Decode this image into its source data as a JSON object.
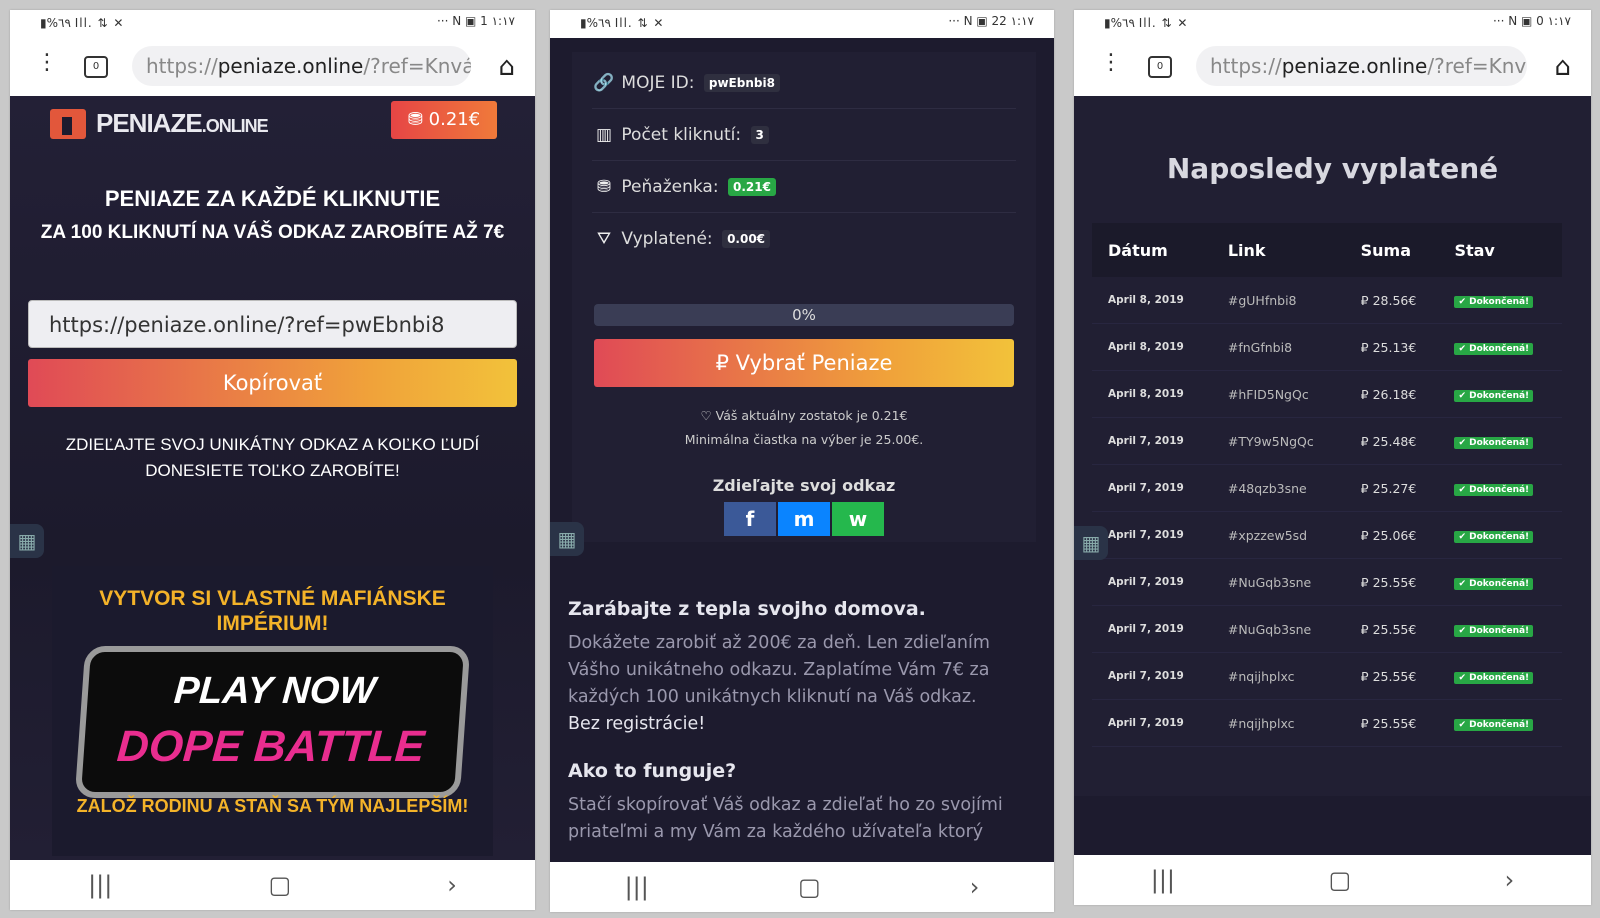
{
  "status_bar": {
    "left": "▮%٦٩ Ill. ⇅ ✕",
    "right": "··· N ▣ 1 ١:١٧",
    "right2": "··· N ▣ 22 ١:١٧",
    "right3": "··· N ▣ 0 ١:١٧"
  },
  "browser": {
    "url_prefix": "https://",
    "url_host": "peniaze.online",
    "url_rest": "/?ref=Knvá",
    "tab_count": "0"
  },
  "panel1": {
    "logo_main": "PENIAZE",
    "logo_sub": ".ONLINE",
    "balance": "0.21€",
    "headline": "PENIAZE ZA KAŽDÉ KLIKNUTIE",
    "subheadline": "ZA 100 KLIKNUTÍ NA VÁŠ ODKAZ ZAROBÍTE AŽ 7€",
    "ref_link": "https://peniaze.online/?ref=pwEbnbi8",
    "copy_button": "Kopírovať",
    "share_text": "ZDIEĽAJTE SVOJ UNIKÁTNY ODKAZ A KOĽKO ĽUDÍ DONESIETE TOĽKO ZAROBÍTE!",
    "banner": {
      "top": "VYTVOR SI VLASTNÉ MAFIÁNSKE IMPÉRIUM!",
      "play": "PLAY NOW",
      "game": "DOPE BATTLE",
      "bottom": "ZALOŽ RODINU A STAŇ SA TÝM NAJLEPŠÍM!"
    }
  },
  "panel2": {
    "my_id_label": "MOJE ID:",
    "my_id": "pwEbnbi8",
    "clicks_label": "Počet kliknutí:",
    "clicks": "3",
    "wallet_label": "Peňaženka:",
    "wallet": "0.21€",
    "paid_label": "Vyplatené:",
    "paid": "0.00€",
    "progress_text": "0%",
    "progress_fraction": 0,
    "withdraw_button": "Vybrať Peniaze",
    "balance_note": "Váš aktuálny zostatok je 0.21€",
    "min_note": "Minimálna čiastka na výber je 25.00€.",
    "share_heading": "Zdieľajte svoj odkaz",
    "share_buttons": [
      "f",
      "m",
      "w"
    ],
    "earn_heading": "Zarábajte z tepla svojho domova.",
    "earn_text": "Dokážete zarobiť až 200€ za deň. Len zdieľaním Vášho unikátneho odkazu. Zaplatíme Vám 7€ za každých 100 unikátnych kliknutí na Váš odkaz.",
    "earn_bold": "Bez registrácie!",
    "how_heading": "Ako to funguje?",
    "how_text": "Stačí skopírovať Váš odkaz a zdieľať ho zo svojími priateľmi a my Vám za každého užívateľa ktorý"
  },
  "panel3": {
    "title": "Naposledy vyplatené",
    "columns": [
      "Dátum",
      "Link",
      "Suma",
      "Stav"
    ],
    "rows": [
      {
        "date": "April 8, 2019",
        "link": "#gUHfnbi8",
        "sum": "28.56€",
        "status": "Dokončená!"
      },
      {
        "date": "April 8, 2019",
        "link": "#fnGfnbi8",
        "sum": "25.13€",
        "status": "Dokončená!"
      },
      {
        "date": "April 8, 2019",
        "link": "#hFID5NgQc",
        "sum": "26.18€",
        "status": "Dokončená!"
      },
      {
        "date": "April 7, 2019",
        "link": "#TY9w5NgQc",
        "sum": "25.48€",
        "status": "Dokončená!"
      },
      {
        "date": "April 7, 2019",
        "link": "#48qzb3sne",
        "sum": "25.27€",
        "status": "Dokončená!"
      },
      {
        "date": "April 7, 2019",
        "link": "#xpzzew5sd",
        "sum": "25.06€",
        "status": "Dokončená!"
      },
      {
        "date": "April 7, 2019",
        "link": "#NuGqb3sne",
        "sum": "25.55€",
        "status": "Dokončená!"
      },
      {
        "date": "April 7, 2019",
        "link": "#NuGqb3sne",
        "sum": "25.55€",
        "status": "Dokončená!"
      },
      {
        "date": "April 7, 2019",
        "link": "#nqijhplxc",
        "sum": "25.55€",
        "status": "Dokončená!"
      },
      {
        "date": "April 7, 2019",
        "link": "#nqijhplxc",
        "sum": "25.55€",
        "status": "Dokončená!"
      }
    ]
  },
  "colors": {
    "accent_start": "#e04a56",
    "accent_end": "#f2c23a",
    "bg_dark": "#1d1b2e",
    "success": "#28a745"
  }
}
